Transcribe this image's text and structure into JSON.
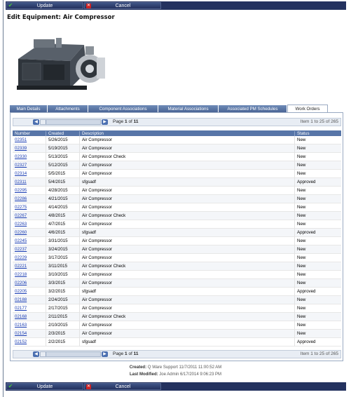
{
  "toolbar": {
    "update_label": "Update",
    "cancel_label": "Cancel"
  },
  "page": {
    "title": "Edit Equipment: Air Compressor"
  },
  "tabs": [
    {
      "label": "Main Details",
      "w": 54
    },
    {
      "label": "Attachments",
      "w": 58
    },
    {
      "label": "Component Associations",
      "w": 100
    },
    {
      "label": "Material Associations",
      "w": 86
    },
    {
      "label": "Associated PM Schedules",
      "w": 98
    },
    {
      "label": "Work Orders",
      "w": 58,
      "active": true
    }
  ],
  "pager": {
    "page_prefix": "Page",
    "page": "1",
    "of": "of",
    "pages": "11",
    "item_range": "Item 1 to 25 of 265"
  },
  "table": {
    "columns": [
      "Number",
      "Created",
      "Description",
      "Status"
    ],
    "rows": [
      [
        "02351",
        "5/26/2015",
        "Air Compressor",
        "New"
      ],
      [
        "02339",
        "5/19/2015",
        "Air Compressor",
        "New"
      ],
      [
        "02330",
        "5/13/2015",
        "Air Compressor Check",
        "New"
      ],
      [
        "02327",
        "5/12/2015",
        "Air Compressor",
        "New"
      ],
      [
        "02314",
        "5/5/2015",
        "Air Compressor",
        "New"
      ],
      [
        "02311",
        "5/4/2015",
        "sfgsadf",
        "Approved"
      ],
      [
        "02295",
        "4/28/2015",
        "Air Compressor",
        "New"
      ],
      [
        "02286",
        "4/21/2015",
        "Air Compressor",
        "New"
      ],
      [
        "02275",
        "4/14/2015",
        "Air Compressor",
        "New"
      ],
      [
        "02267",
        "4/8/2015",
        "Air Compressor Check",
        "New"
      ],
      [
        "02263",
        "4/7/2015",
        "Air Compressor",
        "New"
      ],
      [
        "02260",
        "4/6/2015",
        "sfgsadf",
        "Approved"
      ],
      [
        "02245",
        "3/31/2015",
        "Air Compressor",
        "New"
      ],
      [
        "02237",
        "3/24/2015",
        "Air Compressor",
        "New"
      ],
      [
        "02229",
        "3/17/2015",
        "Air Compressor",
        "New"
      ],
      [
        "02221",
        "3/11/2015",
        "Air Compressor Check",
        "New"
      ],
      [
        "02218",
        "3/10/2015",
        "Air Compressor",
        "New"
      ],
      [
        "02206",
        "3/3/2015",
        "Air Compressor",
        "New"
      ],
      [
        "02205",
        "3/2/2015",
        "sfgsadf",
        "Approved"
      ],
      [
        "02188",
        "2/24/2015",
        "Air Compressor",
        "New"
      ],
      [
        "02177",
        "2/17/2015",
        "Air Compressor",
        "New"
      ],
      [
        "02168",
        "2/11/2015",
        "Air Compressor Check",
        "New"
      ],
      [
        "02163",
        "2/10/2015",
        "Air Compressor",
        "New"
      ],
      [
        "02154",
        "2/3/2015",
        "Air Compressor",
        "New"
      ],
      [
        "02152",
        "2/2/2015",
        "sfgsadf",
        "Approved"
      ]
    ]
  },
  "audit": {
    "created_label": "Created:",
    "created_value": "Q Ware Support 11/7/2011 11:00:52 AM",
    "modified_label": "Last Modified:",
    "modified_value": "Joe Admin 6/17/2014 9:06:23 PM"
  },
  "colors": {
    "toolbar_bg": "#24325f",
    "tab_bg": "#5a76a6",
    "header_bg": "#5775a8",
    "link": "#1a3db3"
  }
}
